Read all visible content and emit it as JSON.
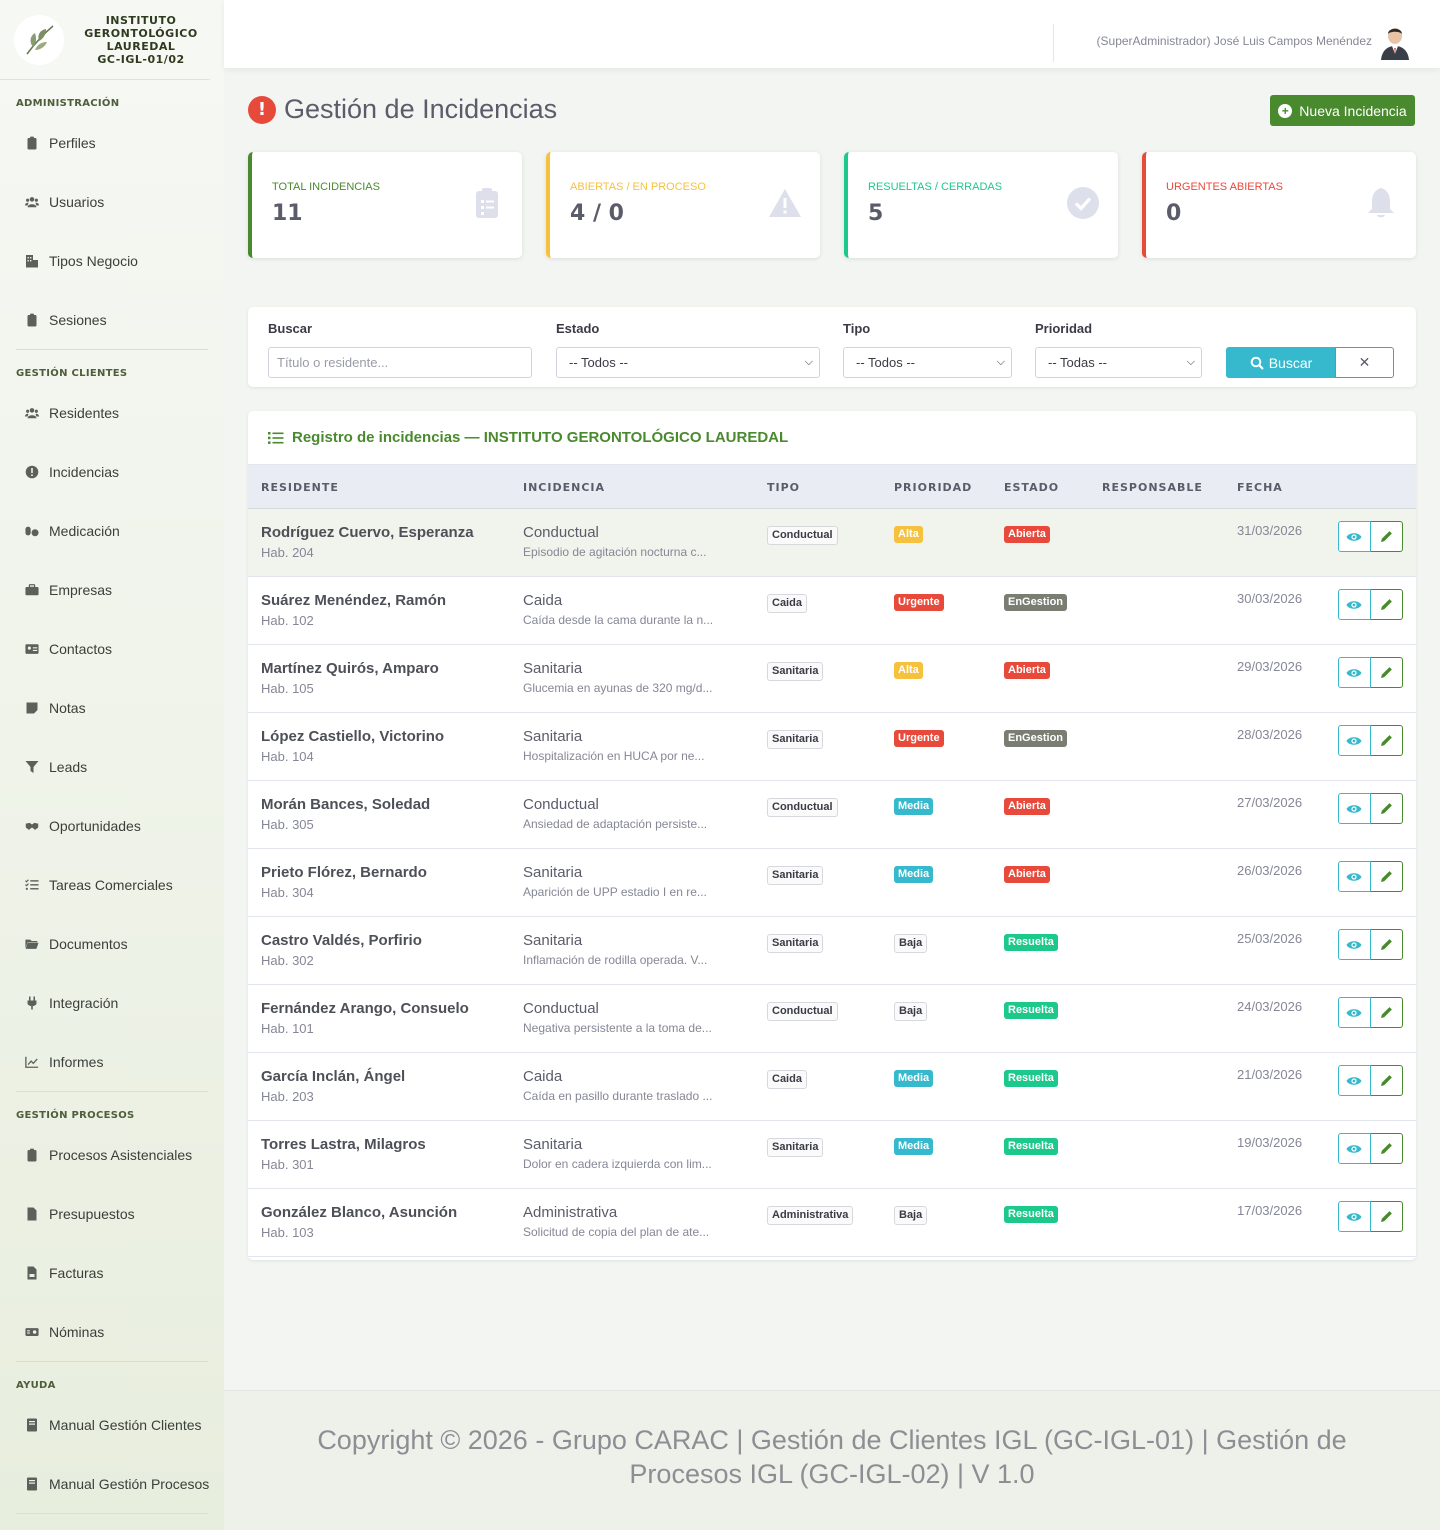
{
  "brand": {
    "line1": "INSTITUTO",
    "line2": "GERONTOLÓGICO",
    "line3": "LAUREDAL",
    "line4": "GC-IGL-01/02"
  },
  "sidebar": {
    "sections": [
      {
        "heading": "ADMINISTRACIÓN",
        "items": [
          {
            "label": "Perfiles",
            "icon": "clipboard-icon"
          },
          {
            "label": "Usuarios",
            "icon": "users-icon"
          },
          {
            "label": "Tipos Negocio",
            "icon": "building-icon"
          },
          {
            "label": "Sesiones",
            "icon": "clipboard-icon"
          }
        ]
      },
      {
        "heading": "GESTIÓN CLIENTES",
        "items": [
          {
            "label": "Residentes",
            "icon": "users-icon"
          },
          {
            "label": "Incidencias",
            "icon": "exclamation-circle-icon"
          },
          {
            "label": "Medicación",
            "icon": "pills-icon"
          },
          {
            "label": "Empresas",
            "icon": "briefcase-icon"
          },
          {
            "label": "Contactos",
            "icon": "address-card-icon"
          },
          {
            "label": "Notas",
            "icon": "note-icon"
          },
          {
            "label": "Leads",
            "icon": "funnel-icon"
          },
          {
            "label": "Oportunidades",
            "icon": "handshake-icon"
          },
          {
            "label": "Tareas Comerciales",
            "icon": "tasks-icon"
          },
          {
            "label": "Documentos",
            "icon": "folder-icon"
          },
          {
            "label": "Integración",
            "icon": "plug-icon"
          },
          {
            "label": "Informes",
            "icon": "chart-line-icon"
          }
        ]
      },
      {
        "heading": "GESTIÓN PROCESOS",
        "items": [
          {
            "label": "Procesos Asistenciales",
            "icon": "clipboard-icon"
          },
          {
            "label": "Presupuestos",
            "icon": "file-icon"
          },
          {
            "label": "Facturas",
            "icon": "invoice-icon"
          },
          {
            "label": "Nóminas",
            "icon": "money-icon"
          }
        ]
      },
      {
        "heading": "AYUDA",
        "items": [
          {
            "label": "Manual Gestión Clientes",
            "icon": "book-icon"
          },
          {
            "label": "Manual Gestión Procesos",
            "icon": "book-icon"
          }
        ]
      }
    ]
  },
  "topbar": {
    "user": "(SuperAdministrador) José Luis Campos Menéndez"
  },
  "page": {
    "title": "Gestión de Incidencias",
    "new_button": "Nueva Incidencia"
  },
  "cards": [
    {
      "label": "TOTAL INCIDENCIAS",
      "value": "11",
      "color": "#4a8a2e",
      "icon": "clipboard-list-icon"
    },
    {
      "label": "ABIERTAS / EN PROCESO",
      "value": "4 / 0",
      "color": "#f6c23e",
      "icon": "warning-icon"
    },
    {
      "label": "RESUELTAS / CERRADAS",
      "value": "5",
      "color": "#1cc88a",
      "icon": "check-circle-icon"
    },
    {
      "label": "URGENTES ABIERTAS",
      "value": "0",
      "color": "#e74a3b",
      "icon": "bell-icon"
    }
  ],
  "filters": {
    "buscar_label": "Buscar",
    "buscar_placeholder": "Título o residente...",
    "estado_label": "Estado",
    "estado_value": "-- Todos --",
    "tipo_label": "Tipo",
    "tipo_value": "-- Todos --",
    "prioridad_label": "Prioridad",
    "prioridad_value": "-- Todas --",
    "search_button": "Buscar",
    "clear_button": "✕"
  },
  "table": {
    "title": "Registro de incidencias — INSTITUTO GERONTOLÓGICO LAUREDAL",
    "headers": [
      "RESIDENTE",
      "INCIDENCIA",
      "TIPO",
      "PRIORIDAD",
      "ESTADO",
      "RESPONSABLE",
      "FECHA"
    ],
    "rows": [
      {
        "name": "Rodríguez Cuervo, Esperanza",
        "room": "Hab. 204",
        "incidencia": "Conductual",
        "desc": "Episodio de agitación nocturna c...",
        "tipo": "Conductual",
        "prioridad": "Alta",
        "estado": "Abierta",
        "responsable": "",
        "fecha": "31/03/2026"
      },
      {
        "name": "Suárez Menéndez, Ramón",
        "room": "Hab. 102",
        "incidencia": "Caida",
        "desc": "Caída desde la cama durante la n...",
        "tipo": "Caida",
        "prioridad": "Urgente",
        "estado": "EnGestion",
        "responsable": "",
        "fecha": "30/03/2026"
      },
      {
        "name": "Martínez Quirós, Amparo",
        "room": "Hab. 105",
        "incidencia": "Sanitaria",
        "desc": "Glucemia en ayunas de 320 mg/d...",
        "tipo": "Sanitaria",
        "prioridad": "Alta",
        "estado": "Abierta",
        "responsable": "",
        "fecha": "29/03/2026"
      },
      {
        "name": "López Castiello, Victorino",
        "room": "Hab. 104",
        "incidencia": "Sanitaria",
        "desc": "Hospitalización en HUCA por ne...",
        "tipo": "Sanitaria",
        "prioridad": "Urgente",
        "estado": "EnGestion",
        "responsable": "",
        "fecha": "28/03/2026"
      },
      {
        "name": "Morán Bances, Soledad",
        "room": "Hab. 305",
        "incidencia": "Conductual",
        "desc": "Ansiedad de adaptación persiste...",
        "tipo": "Conductual",
        "prioridad": "Media",
        "estado": "Abierta",
        "responsable": "",
        "fecha": "27/03/2026"
      },
      {
        "name": "Prieto Flórez, Bernardo",
        "room": "Hab. 304",
        "incidencia": "Sanitaria",
        "desc": "Aparición de UPP estadio I en re...",
        "tipo": "Sanitaria",
        "prioridad": "Media",
        "estado": "Abierta",
        "responsable": "",
        "fecha": "26/03/2026"
      },
      {
        "name": "Castro Valdés, Porfirio",
        "room": "Hab. 302",
        "incidencia": "Sanitaria",
        "desc": "Inflamación de rodilla operada. V...",
        "tipo": "Sanitaria",
        "prioridad": "Baja",
        "estado": "Resuelta",
        "responsable": "",
        "fecha": "25/03/2026"
      },
      {
        "name": "Fernández Arango, Consuelo",
        "room": "Hab. 101",
        "incidencia": "Conductual",
        "desc": "Negativa persistente a la toma de...",
        "tipo": "Conductual",
        "prioridad": "Baja",
        "estado": "Resuelta",
        "responsable": "",
        "fecha": "24/03/2026"
      },
      {
        "name": "García Inclán, Ángel",
        "room": "Hab. 203",
        "incidencia": "Caida",
        "desc": "Caída en pasillo durante traslado ...",
        "tipo": "Caida",
        "prioridad": "Media",
        "estado": "Resuelta",
        "responsable": "",
        "fecha": "21/03/2026"
      },
      {
        "name": "Torres Lastra, Milagros",
        "room": "Hab. 301",
        "incidencia": "Sanitaria",
        "desc": "Dolor en cadera izquierda con lim...",
        "tipo": "Sanitaria",
        "prioridad": "Media",
        "estado": "Resuelta",
        "responsable": "",
        "fecha": "19/03/2026"
      },
      {
        "name": "González Blanco, Asunción",
        "room": "Hab. 103",
        "incidencia": "Administrativa",
        "desc": "Solicitud de copia del plan de ate...",
        "tipo": "Administrativa",
        "prioridad": "Baja",
        "estado": "Resuelta",
        "responsable": "",
        "fecha": "17/03/2026"
      }
    ]
  },
  "colors": {
    "prioridad": {
      "Alta": "#f6c23e",
      "Urgente": "#e74a3b",
      "Media": "#36b9cc",
      "Baja": ""
    },
    "estado": {
      "Abierta": "#e74a3b",
      "EnGestion": "#7a7d72",
      "Resuelta": "#1cc88a"
    }
  },
  "footer": {
    "text": "Copyright © 2026 - Grupo CARAC | Gestión de Clientes IGL (GC-IGL-01) | Gestión de Procesos IGL (GC-IGL-02) | V 1.0"
  }
}
